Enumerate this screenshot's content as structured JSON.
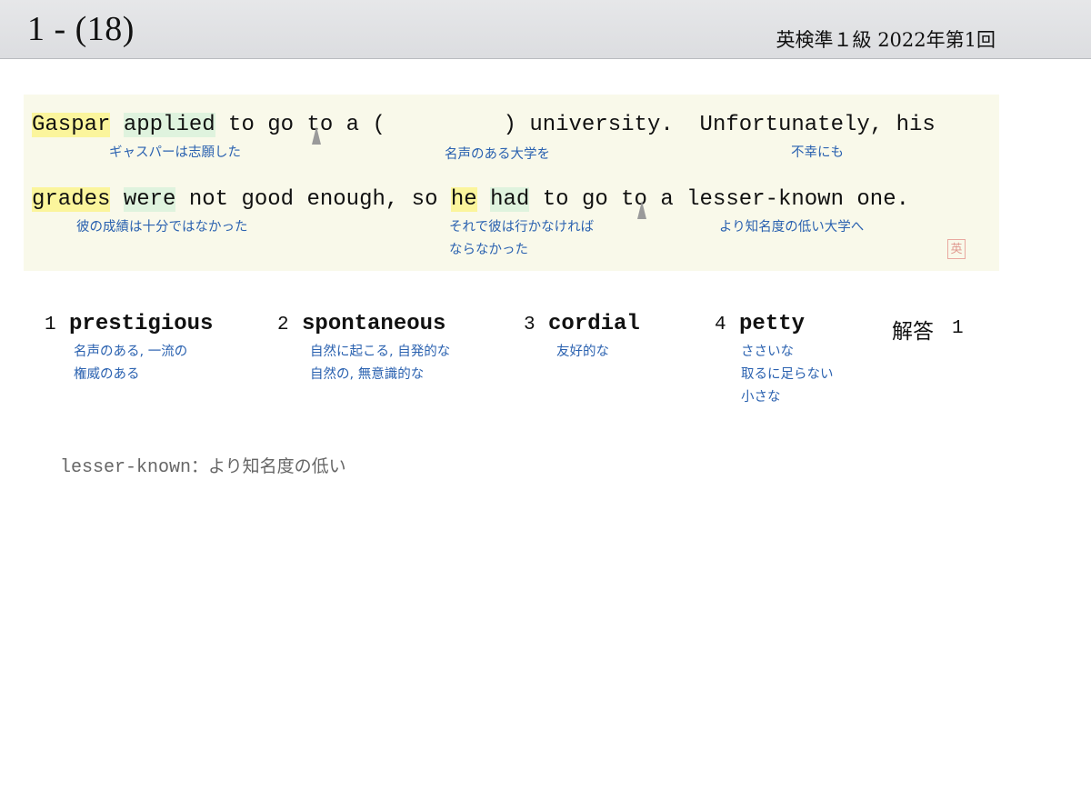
{
  "header": {
    "question_number": "1 - (18)",
    "exam_info": "英検準１級  2022年第1回"
  },
  "sentence": {
    "line1": {
      "gaspar": "Gaspar",
      "sp1": " ",
      "applied": "applied",
      "rest1": " to go to a (",
      "blank": "         ",
      "rest2": ") university.  Unfortunately, his"
    },
    "line2": {
      "grades": "grades",
      "sp1": " ",
      "were": "were",
      "rest1": " not good enough, so ",
      "he": "he",
      "sp2": " ",
      "had": "had",
      "rest2": " to go to a lesser-known one."
    },
    "glosses": {
      "g1": "ギャスパーは志願した",
      "g2": "名声のある大学を",
      "g3": "不幸にも",
      "g4": "彼の成績は十分ではなかった",
      "g5a": "それで彼は行かなければ",
      "g5b": "ならなかった",
      "g6": "より知名度の低い大学へ"
    },
    "stamp": "英"
  },
  "choices": [
    {
      "num": "1",
      "word": "prestigious",
      "meaning_lines": [
        "名声のある, 一流の",
        "権威のある"
      ]
    },
    {
      "num": "2",
      "word": "spontaneous",
      "meaning_lines": [
        "自然に起こる, 自発的な",
        "自然の, 無意識的な"
      ]
    },
    {
      "num": "3",
      "word": "cordial",
      "meaning_lines": [
        "友好的な"
      ]
    },
    {
      "num": "4",
      "word": "petty",
      "meaning_lines": [
        "ささいな",
        "取るに足らない",
        "小さな"
      ]
    }
  ],
  "answer": {
    "label": "解答",
    "value": "1"
  },
  "vocab": {
    "term": "lesser-known",
    "sep": "：",
    "definition": "より知名度の低い"
  }
}
